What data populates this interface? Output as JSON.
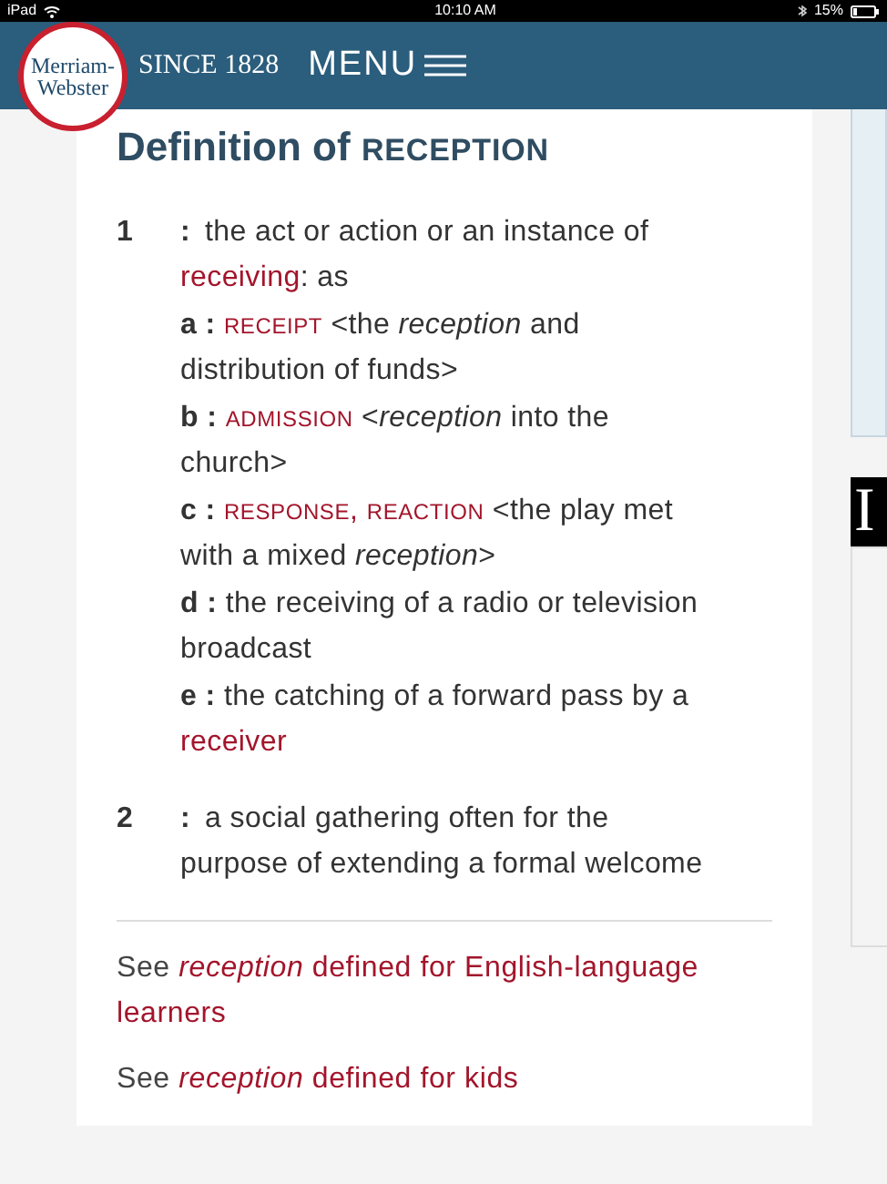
{
  "status_bar": {
    "device": "iPad",
    "time": "10:10 AM",
    "battery": "15%"
  },
  "header": {
    "logo_line_1": "Merriam-",
    "logo_line_2": "Webster",
    "tagline": "SINCE 1828",
    "menu": "MENU"
  },
  "entry": {
    "title": "Definition of",
    "headword": "RECEPTION",
    "senses": [
      {
        "number": "1",
        "colon": ":",
        "parts": [
          {
            "kind": "text",
            "text": "the act or action or an instance of"
          },
          {
            "kind": "link",
            "text": "receiving"
          },
          {
            "kind": "suffix",
            "text": ": as"
          }
        ],
        "subsenses": [
          {
            "letter": "a",
            "colon": ":",
            "parts": [
              {
                "kind": "caps",
                "text": "RECEIPT"
              },
              {
                "kind": "text",
                "text": "<the *reception* and distribution of funds>"
              }
            ]
          },
          {
            "letter": "b",
            "colon": ":",
            "parts": [
              {
                "kind": "caps",
                "text": "ADMISSION"
              },
              {
                "kind": "text",
                "text": "<*reception* into the church>"
              }
            ]
          },
          {
            "letter": "c",
            "colon": ":",
            "parts": [
              {
                "kind": "caps",
                "text": "RESPONSE"
              },
              {
                "kind": "glue",
                "text": ","
              },
              {
                "kind": "caps",
                "text": "REACTION"
              },
              {
                "kind": "text",
                "text": "<the play met with a mixed *reception*>"
              }
            ]
          },
          {
            "letter": "d",
            "colon": ":",
            "parts": [
              {
                "kind": "text",
                "text": "the receiving of a radio or television broadcast"
              }
            ]
          },
          {
            "letter": "e",
            "colon": ":",
            "parts": [
              {
                "kind": "text",
                "text": "the catching of a forward pass by a"
              },
              {
                "kind": "link",
                "text": "receiver"
              }
            ]
          }
        ]
      },
      {
        "number": "2",
        "colon": ":",
        "parts": [
          {
            "kind": "text",
            "text": "a social gathering often for the purpose of extending a formal welcome"
          }
        ]
      }
    ],
    "see_also": [
      {
        "prefix": "See",
        "text": "*reception* defined for English-language learners"
      },
      {
        "prefix": "See",
        "text": "*reception* defined for kids"
      }
    ]
  },
  "right_rail": {
    "ad_letter": "I"
  }
}
